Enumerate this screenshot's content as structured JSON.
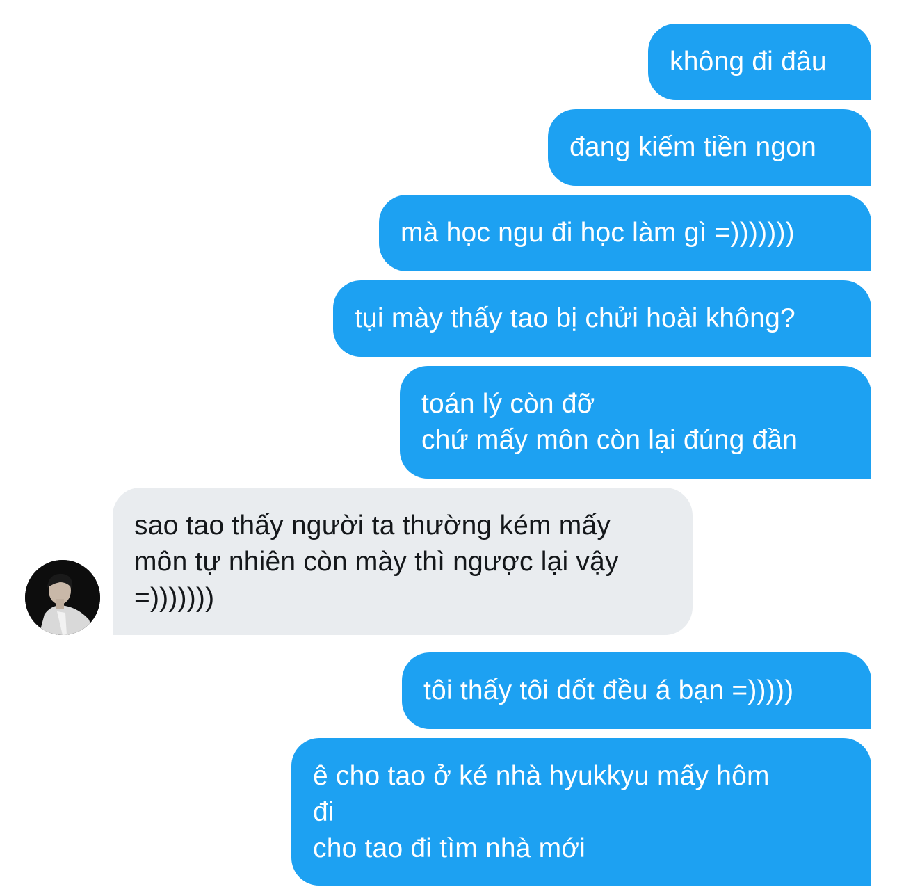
{
  "conversation": {
    "messages": [
      {
        "direction": "sent",
        "text": "không đi đâu"
      },
      {
        "direction": "sent",
        "text": "đang kiếm tiền ngon"
      },
      {
        "direction": "sent",
        "text": "mà học ngu đi học làm gì =)))))))"
      },
      {
        "direction": "sent",
        "text": "tụi mày thấy tao bị chửi hoài không?"
      },
      {
        "direction": "sent",
        "text": "toán lý còn đỡ\nchứ mấy môn còn lại đúng đần"
      },
      {
        "direction": "received",
        "text": "sao tao thấy người ta thường kém mấy\nmôn tự nhiên còn mày thì ngược lại vậy\n=)))))))"
      },
      {
        "direction": "sent",
        "text": "tôi thấy tôi dốt đều á bạn =)))))"
      },
      {
        "direction": "sent",
        "text": "ê cho tao ở ké nhà hyukkyu mấy hôm\nđi\ncho tao đi tìm nhà mới"
      }
    ],
    "colors": {
      "sent_bubble": "#1da1f2",
      "received_bubble": "#e9ecef",
      "sent_text": "#ffffff",
      "received_text": "#14171a"
    }
  }
}
